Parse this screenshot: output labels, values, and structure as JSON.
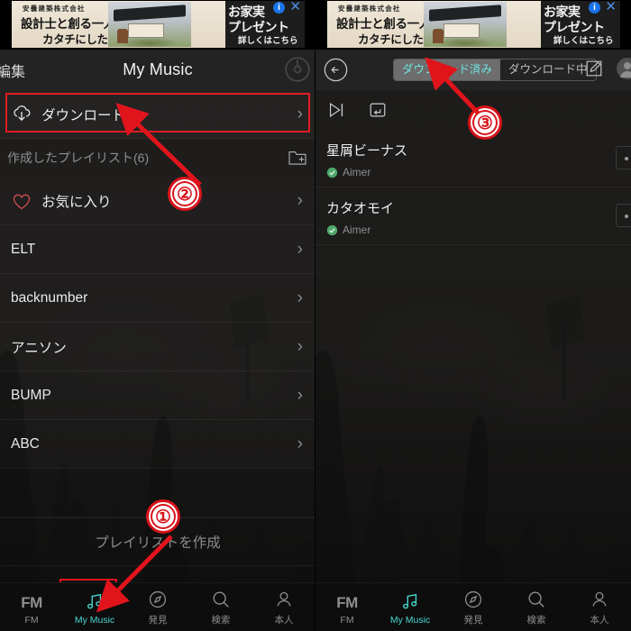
{
  "ad": {
    "corp": "安曇建築株式会社",
    "line1": "設計士と創る一人一人の夢を",
    "line2": "カタチにした住まい",
    "right_line1": "お家実",
    "right_line2": "プレゼント",
    "right_line3": "詳しくはこちら",
    "info_glyph": "i",
    "close_glyph": "✕"
  },
  "left": {
    "header": {
      "edit_label": "編集",
      "title": "My Music",
      "disc_icon": "disc-icon"
    },
    "download_row": {
      "label": "ダウンロード",
      "icon": "cloud-download-icon",
      "chevron": "›"
    },
    "section": {
      "label": "作成したプレイリスト(6)",
      "add_icon": "folder-plus-icon"
    },
    "playlists": [
      {
        "label": "お気に入り",
        "icon": "heart-icon",
        "chevron": "›"
      },
      {
        "label": "ELT",
        "icon": "",
        "chevron": "›"
      },
      {
        "label": "backnumber",
        "icon": "",
        "chevron": "›"
      },
      {
        "label": "アニソン",
        "icon": "",
        "chevron": "›"
      },
      {
        "label": "BUMP",
        "icon": "",
        "chevron": "›"
      },
      {
        "label": "ABC",
        "icon": "",
        "chevron": "›"
      }
    ],
    "create_label": "プレイリストを作成"
  },
  "right": {
    "header": {
      "back_icon": "back-arrow-icon",
      "segments": [
        {
          "label": "ダウンロード済み",
          "selected": true
        },
        {
          "label": "ダウンロード中",
          "selected": false
        }
      ],
      "edit_icon": "edit-square-icon",
      "avatar_icon": "avatar-icon"
    },
    "subtoolbar": {
      "play_next_icon": "play-next-icon",
      "download_box_icon": "download-box-icon"
    },
    "songs": [
      {
        "title": "星屑ビーナス",
        "artist": "Aimer",
        "status_icon": "check-circle-icon",
        "more_icon": "more-icon"
      },
      {
        "title": "カタオモイ",
        "artist": "Aimer",
        "status_icon": "check-circle-icon",
        "more_icon": "more-icon"
      }
    ]
  },
  "tabbar": {
    "tabs": [
      {
        "label": "FM",
        "icon": "fm-icon",
        "active": false
      },
      {
        "label": "My Music",
        "icon": "music-note-icon",
        "active": true
      },
      {
        "label": "発見",
        "icon": "compass-icon",
        "active": false
      },
      {
        "label": "検索",
        "icon": "search-icon",
        "active": false
      },
      {
        "label": "本人",
        "icon": "person-icon",
        "active": false
      }
    ]
  },
  "annotations": {
    "markers": [
      {
        "number": "①"
      },
      {
        "number": "②"
      },
      {
        "number": "③"
      }
    ],
    "accent_color": "#d7121a",
    "highlight_color": "#e1141c"
  },
  "colors": {
    "accent_cyan": "#48d7cf",
    "annotation_red": "#d7121a",
    "header_bg": "#232323",
    "tabbar_bg": "#0d0d0d"
  }
}
